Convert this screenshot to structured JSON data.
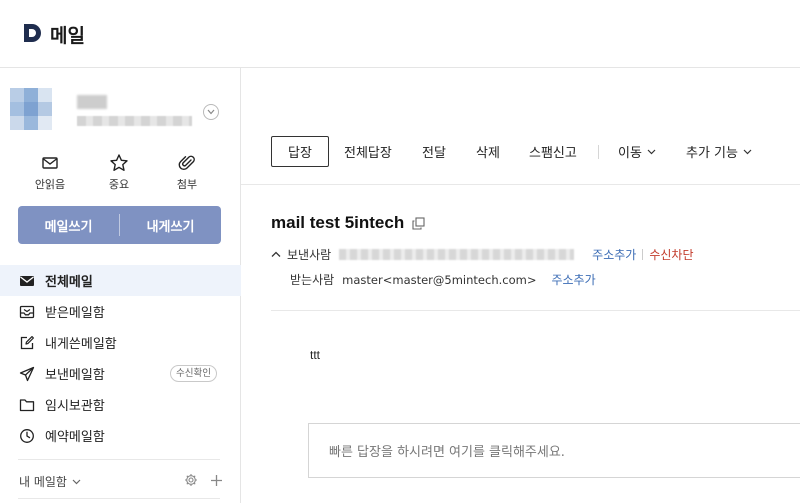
{
  "app": {
    "logo_letter": "D",
    "title": "메일"
  },
  "profile": {
    "toggle_icon": "chevron-down-icon"
  },
  "quick_actions": [
    {
      "label": "안읽음",
      "icon": "envelope-icon"
    },
    {
      "label": "중요",
      "icon": "star-icon"
    },
    {
      "label": "첨부",
      "icon": "paperclip-icon"
    }
  ],
  "compose": {
    "write_label": "메일쓰기",
    "self_label": "내게쓰기",
    "color": "#7f92c2"
  },
  "nav": [
    {
      "label": "전체메일",
      "icon": "mail-filled-icon",
      "active": true
    },
    {
      "label": "받은메일함",
      "icon": "inbox-icon"
    },
    {
      "label": "내게쓴메일함",
      "icon": "edit-square-icon"
    },
    {
      "label": "보낸메일함",
      "icon": "send-icon",
      "badge": "수신확인"
    },
    {
      "label": "임시보관함",
      "icon": "folder-icon"
    },
    {
      "label": "예약메일함",
      "icon": "clock-icon"
    }
  ],
  "my_mailbox": {
    "label": "내 메일함"
  },
  "toolbar": {
    "reply": "답장",
    "reply_all": "전체답장",
    "forward": "전달",
    "delete": "삭제",
    "spam": "스팸신고",
    "move": "이동",
    "more": "추가 기능"
  },
  "message": {
    "subject": "mail test 5intech",
    "from_label": "보낸사람",
    "to_label": "받는사람",
    "to_value": "master<master@5mintech.com>",
    "add_contact": "주소추가",
    "block": "수신차단",
    "body": "ttt"
  },
  "quick_reply": {
    "placeholder": "빠른 답장을 하시려면 여기를 클릭해주세요."
  }
}
